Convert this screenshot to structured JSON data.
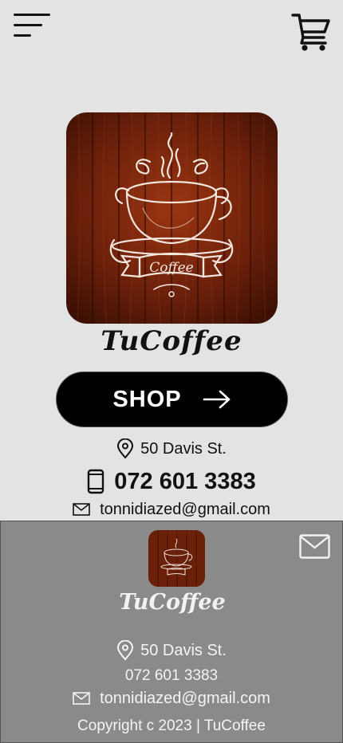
{
  "header": {
    "menu_icon": "hamburger-menu-icon",
    "cart_icon": "shopping-cart-icon"
  },
  "brand": {
    "name": "TuCoffee",
    "logo_text": "Coffee",
    "colors": {
      "wood_dark": "#4a1505",
      "wood_light": "#8a2e0f",
      "accent": "#000000"
    }
  },
  "shop_button": {
    "label": "SHOP",
    "icon": "arrow-right-icon"
  },
  "contact": {
    "address": "50 Davis St.",
    "phone": "072 601 3383",
    "email": "tonnidiazed@gmail.com"
  },
  "footer": {
    "brand": "TuCoffee",
    "address": "50 Davis St.",
    "phone": "072 601 3383",
    "email": "tonnidiazed@gmail.com",
    "copyright": "Copyright c 2023 | TuCoffee",
    "mail_icon": "envelope-icon",
    "background": "#8a8a8a"
  }
}
